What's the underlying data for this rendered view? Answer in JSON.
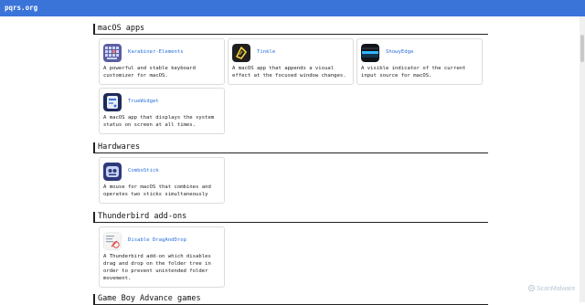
{
  "site": {
    "brand": "pqrs.org"
  },
  "sections": [
    {
      "title": "macOS apps",
      "cards": [
        {
          "name": "Karabiner-Elements",
          "description": "A powerful and stable keyboard customizer for macOS."
        },
        {
          "name": "Tinkle",
          "description": "A macOS app that appends a visual effect at the focused window changes."
        },
        {
          "name": "ShowyEdge",
          "description": "A visible indicator of the current input source for macOS."
        },
        {
          "name": "TrueWidget",
          "description": "A macOS app that displays the system status on screen at all times."
        }
      ]
    },
    {
      "title": "Hardwares",
      "cards": [
        {
          "name": "ComboStick",
          "description": "A mouse for macOS that combines and operates two sticks simultaneously"
        }
      ]
    },
    {
      "title": "Thunderbird add-ons",
      "cards": [
        {
          "name": "Disable DragAndDrop",
          "description": "A Thunderbird add-on which disables drag and drop on the folder tree in order to prevent unintended folder movement."
        }
      ]
    },
    {
      "title": "Game Boy Advance games",
      "cards": []
    }
  ],
  "watermark": {
    "text": "ScanMalware"
  },
  "colors": {
    "topbar": "#3b74d9",
    "link": "#2a6fdb"
  }
}
